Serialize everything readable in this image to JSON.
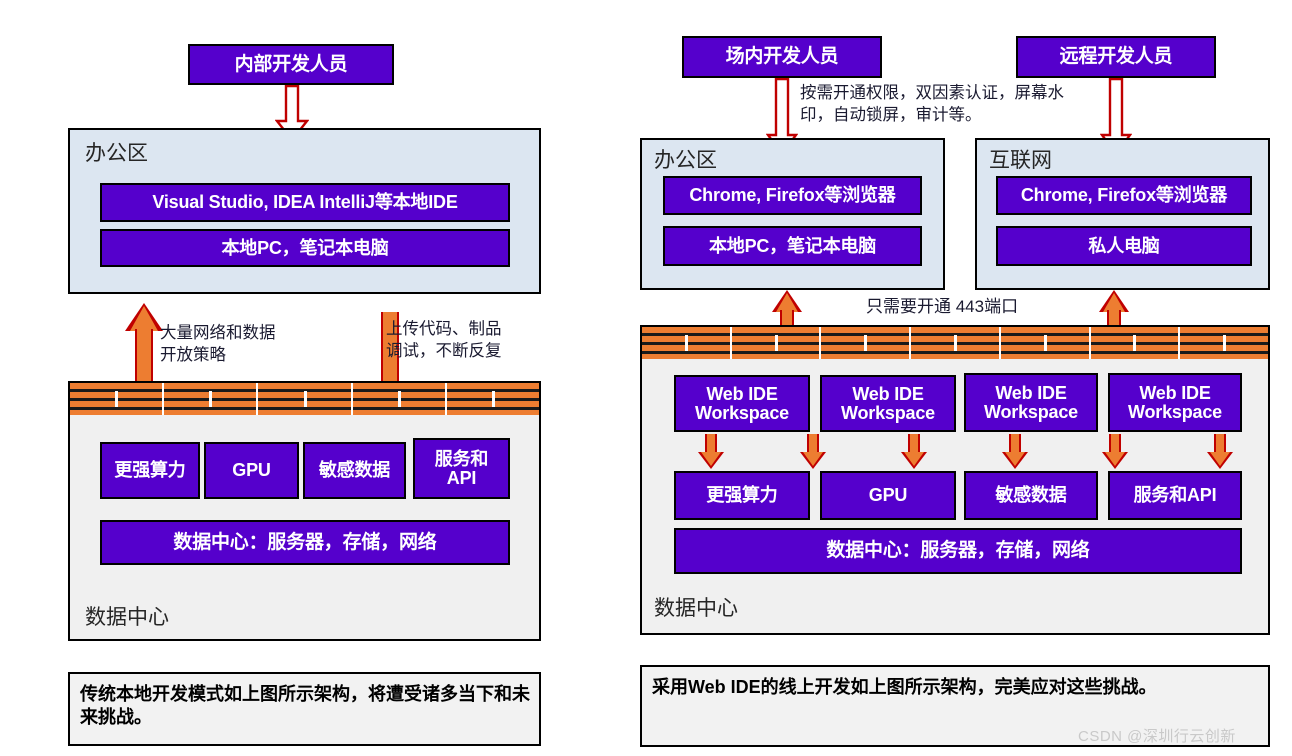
{
  "colors": {
    "purple_box": "#5500CC",
    "office_zone": "#dce6f1",
    "datacenter_zone": "#f0f0f0",
    "arrow_orange": "#ED7D31",
    "arrow_outline": "#C00000",
    "firewall_brick": "#ED7D31",
    "firewall_mortar": "#1a1a1a",
    "caption_background": "#f2f2f2"
  },
  "left_diagram": {
    "actor": {
      "label": "内部开发人员"
    },
    "office_zone": {
      "label": "办公区",
      "boxes": [
        {
          "label": "Visual Studio, IDEA IntelliJ等本地IDE"
        },
        {
          "label": "本地PC，笔记本电脑"
        }
      ]
    },
    "notes": [
      {
        "label": "大量网络和数据\n开放策略"
      },
      {
        "label": "上传代码、制品\n调试，不断反复"
      }
    ],
    "firewall": {
      "name": "firewall-brick-wall",
      "segments": 5
    },
    "datacenter_zone": {
      "label": "数据中心",
      "resources": [
        {
          "label": "更强算力"
        },
        {
          "label": "GPU"
        },
        {
          "label": "敏感数据"
        },
        {
          "label": "服务和\nAPI"
        }
      ],
      "foundation": {
        "label": "数据中心：服务器，存储，网络"
      }
    },
    "caption": {
      "label": "  传统本地开发模式如上图所示架构，将遭受诸多当下和未来挑战。"
    }
  },
  "right_diagram": {
    "actors": [
      {
        "label": "场内开发人员"
      },
      {
        "label": "远程开发人员"
      }
    ],
    "policy_note": {
      "label": "按需开通权限，双因素认证，屏幕水\n印，自动锁屏，审计等。"
    },
    "port_note": {
      "label": "只需要开通 443端口"
    },
    "office_zone": {
      "label": "办公区",
      "boxes": [
        {
          "label": "Chrome, Firefox等浏览器"
        },
        {
          "label": "本地PC，笔记本电脑"
        }
      ]
    },
    "internet_zone": {
      "label": "互联网",
      "boxes": [
        {
          "label": "Chrome, Firefox等浏览器"
        },
        {
          "label": "私人电脑"
        }
      ]
    },
    "firewall": {
      "name": "firewall-brick-wall",
      "segments": 7
    },
    "datacenter_zone": {
      "label": "数据中心",
      "workspaces": [
        {
          "label": "Web IDE\nWorkspace"
        },
        {
          "label": "Web IDE\nWorkspace"
        },
        {
          "label": "Web IDE\nWorkspace"
        },
        {
          "label": "Web IDE\nWorkspace"
        }
      ],
      "resources": [
        {
          "label": "更强算力"
        },
        {
          "label": "GPU"
        },
        {
          "label": "敏感数据"
        },
        {
          "label": "服务和API"
        }
      ],
      "foundation": {
        "label": "数据中心：服务器，存储，网络"
      }
    },
    "caption": {
      "label": "  采用Web IDE的线上开发如上图所示架构，完美应对这些挑战。"
    }
  },
  "watermark": {
    "label": "CSDN @深圳行云创新"
  }
}
